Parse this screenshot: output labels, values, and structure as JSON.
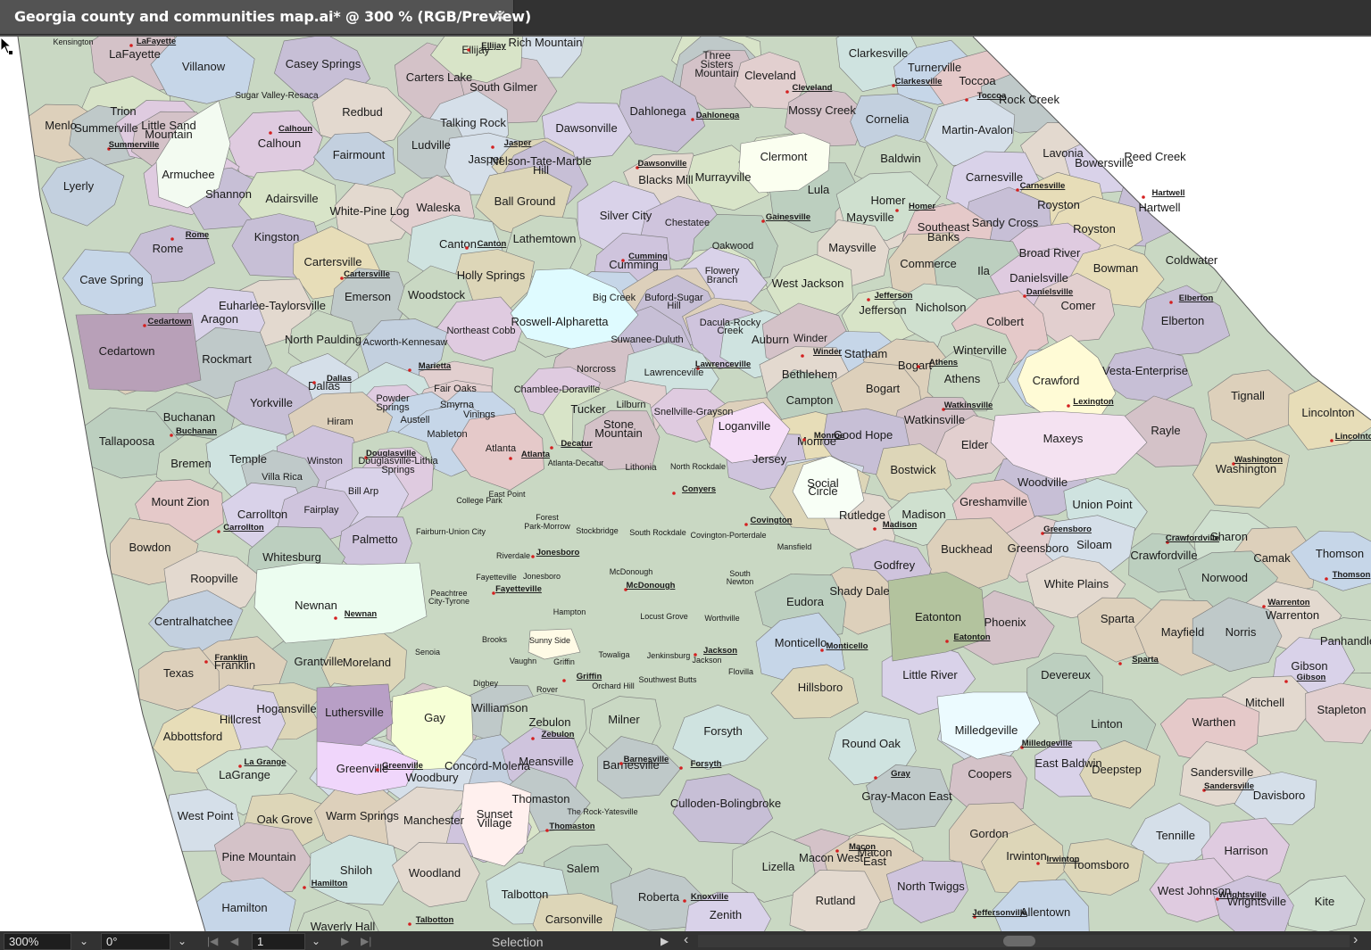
{
  "window": {
    "tab_title": "Georgia county and communities map.ai* @ 300 % (RGB/Preview)",
    "close_glyph": "✕"
  },
  "map": {
    "background": "#ffffff",
    "border_color": "#7a7a7a",
    "palette": [
      "#cfc4dd",
      "#c9d8c3",
      "#e2cfcf",
      "#d5dfe9",
      "#ddd6b8",
      "#c3d0df",
      "#dfcbe0",
      "#cfe0cf",
      "#e3d9cf",
      "#bfc9c9",
      "#d9d2e9",
      "#cfe3e0",
      "#e7ddb8",
      "#c7bfd6",
      "#d8e4c8",
      "#e5c9c9",
      "#c6d6e8",
      "#ddd0bb",
      "#bccfbf",
      "#d4c2c8"
    ],
    "highlight_regions": {
      "roswell_alpharetta": "#dffbff",
      "clermont": "#fbfff0",
      "crawford": "#fffbd6",
      "maxeys": "#f4e2f1",
      "armuchee": "#f3fbf1",
      "newnan": "#ecfdf0",
      "gay": "#f6ffd6",
      "greenville": "#f0d6fb",
      "social_circle": "#f8fff6",
      "milledgeville": "#ecfbff",
      "sunset_village": "#fff0ee",
      "sunny_side": "#fffbe6",
      "loganville": "#f6dff8",
      "cedartown": "#b8a0b8",
      "luthersville": "#b89fc6",
      "eatonton": "#b3c39e"
    },
    "city_dot_color": "#d42020",
    "text_color": "#1a1a1a",
    "cities": [
      "LaFayette",
      "Ellijay",
      "Calhoun",
      "Summerville",
      "Rome",
      "Cartersville",
      "Cedartown",
      "Dallas",
      "Marietta",
      "Douglasville",
      "Buchanan",
      "Carrollton",
      "Atlanta",
      "Decatur",
      "Conyers",
      "Covington",
      "Lawrenceville",
      "Gainesville",
      "Cumming",
      "Canton",
      "Jasper",
      "Dahlonega",
      "Dawsonville",
      "Cleveland",
      "Clarkesville",
      "Toccoa",
      "Hartwell",
      "Carnesville",
      "Homer",
      "Jefferson",
      "Danielsville",
      "Elberton",
      "Athens",
      "Winder",
      "Watkinsville",
      "Lexington",
      "Washington",
      "Monroe",
      "Madison",
      "Greensboro",
      "Crawfordville",
      "Warrenton",
      "Thomson",
      "Sparta",
      "Eatonton",
      "Gibson",
      "Milledgeville",
      "Sandersville",
      "Wrightsville",
      "Irwinton",
      "Jeffersonville",
      "Gray",
      "Macon",
      "Knoxville",
      "Forsyth",
      "Monticello",
      "Jackson",
      "McDonough",
      "Jonesboro",
      "Fayetteville",
      "Griffin",
      "Barnesville",
      "Zebulon",
      "Thomaston",
      "Talbotton",
      "Hamilton",
      "Greenville",
      "La Grange",
      "Franklin",
      "Newnan",
      "Lincolnton"
    ],
    "labels": [
      "Kensington",
      "LaFayette",
      "Villanow",
      "Casey Springs",
      "Rich Mountain",
      "Carters Lake",
      "South Gilmer",
      "Three Sisters Mountain",
      "Cleveland",
      "Clarkesville",
      "Turnerville",
      "Toccoa",
      "Rock Creek",
      "Dahlonega",
      "Mossy Creek",
      "Cornelia",
      "Martin-Avalon",
      "Trion",
      "Menlo",
      "Summerville",
      "Little Sand Mountain",
      "Sugar Valley-Resaca",
      "Redbud",
      "Talking Rock",
      "Dawsonville",
      "Calhoun",
      "Fairmount",
      "Ludville",
      "Jasper",
      "Nelson-Tate-Marble Hill",
      "Blacks Mill",
      "Murrayville",
      "Clermont",
      "Baldwin",
      "Lavonia",
      "Bowersville",
      "Reed Creek",
      "Carnesville",
      "Lyerly",
      "Armuchee",
      "Shannon",
      "Adairsville",
      "White-Pine Log",
      "Waleska",
      "Ball Ground",
      "Silver City",
      "Chestatee",
      "Lula",
      "Maysville",
      "Homer",
      "Royston",
      "Hartwell",
      "Sandy Cross",
      "Southeast Banks",
      "Kingston",
      "Rome",
      "Canton",
      "Lathemtown",
      "Cumming",
      "Oakwood",
      "Broad River",
      "Coldwater",
      "Cave Spring",
      "Cartersville",
      "Holly Springs",
      "Flowery Branch",
      "West Jackson",
      "Commerce",
      "Ila",
      "Danielsville",
      "Bowman",
      "Emerson",
      "Woodstock",
      "Big Creek",
      "Buford-Sugar Hill",
      "Comer",
      "Elberton",
      "Euharlee-Taylorsville",
      "Jefferson",
      "Nicholson",
      "Aragon",
      "Roswell-Alpharetta",
      "Dacula-Rocky Creek",
      "Colbert",
      "Northeast Cobb",
      "Suwanee-Duluth",
      "Auburn",
      "North Paulding",
      "Acworth-Kennesaw",
      "Cedartown",
      "Winder",
      "Statham",
      "Winterville",
      "Rockmart",
      "Norcross",
      "Lawrenceville",
      "Bogart",
      "Crawford",
      "Vesta-Enterprise",
      "Dallas",
      "Fair Oaks",
      "Bethlehem",
      "Athens",
      "Chamblee-Doraville",
      "Powder Springs",
      "Smyrna",
      "Tignall",
      "Lincolnton",
      "Buchanan",
      "Yorkville",
      "Austell",
      "Vinings",
      "Lilburn",
      "Tucker",
      "Snellville-Grayson",
      "Campton",
      "Hiram",
      "Mableton",
      "Stone Mountain",
      "Watkinsville",
      "Maxeys",
      "Loganville",
      "Rayle",
      "Tallapoosa",
      "Monroe",
      "Good Hope",
      "Elder",
      "Bremen",
      "Temple",
      "Winston",
      "Douglasville-Lithia Springs",
      "Atlanta",
      "Atlanta-Decatur",
      "Jersey",
      "Bostwick",
      "Lithonia",
      "North Rockdale",
      "Villa Rica",
      "Social Circle",
      "Woodville",
      "Washington",
      "East Point",
      "Bill Arp",
      "College Park",
      "Mount Zion",
      "Carrollton",
      "Fairplay",
      "Forest Park-Morrow",
      "Rutledge",
      "Madison",
      "Greshamville",
      "Union Point",
      "Fairburn-Union City",
      "Stockbridge",
      "South Rockdale",
      "Covington-Porterdale",
      "Bowdon",
      "Palmetto",
      "Riverdale",
      "Greensboro",
      "Crawfordville",
      "Sharon",
      "Whitesburg",
      "Jonesboro",
      "Mansfield",
      "Siloam",
      "Camak",
      "Thomson",
      "South Newton",
      "Buckhead",
      "Godfrey",
      "McDonough",
      "Roopville",
      "Fayetteville",
      "Peachtree City-Tyrone",
      "White Plains",
      "Norwood",
      "Newnan",
      "Shady Dale",
      "Eudora",
      "Hampton",
      "Eatonton",
      "Sparta",
      "Warrenton",
      "Centralhatchee",
      "Locust Grove",
      "Phoenix",
      "Mayfield",
      "Norris",
      "Worthville",
      "Panhandle",
      "Brooks",
      "Sunny Side",
      "Monticello",
      "Grantville",
      "Moreland",
      "Senoia",
      "Towaliga",
      "Jenkinsburg",
      "Franklin",
      "Vaughn",
      "Griffin",
      "Flovilla",
      "Texas",
      "Little River",
      "Devereux",
      "Gibson",
      "Digbey",
      "Southwest Butts",
      "Orchard Hill",
      "Hillsboro",
      "Rover",
      "Hogansville",
      "Luthersville",
      "Gay",
      "Mitchell",
      "Stapleton",
      "Williamson",
      "Milner",
      "Linton",
      "Hillcrest",
      "Forsyth",
      "Milledgeville",
      "Warthen",
      "Zebulon",
      "Round Oak",
      "Abbottsford",
      "East Baldwin",
      "Deepstep",
      "Greenville",
      "Concord-Molena",
      "Meansville",
      "Barnesville",
      "Sandersville",
      "LaGrange",
      "Coopers",
      "Woodbury",
      "Davisboro",
      "Thomaston",
      "Culloden-Bolingbroke",
      "Gray-Macon East",
      "The Rock-Yatesville",
      "West Point",
      "Oak Grove",
      "Warm Springs",
      "Manchester",
      "Sunset Village",
      "Tennille",
      "Gordon",
      "Pine Mountain",
      "Macon West",
      "Macon East",
      "Irwinton",
      "Toomsboro",
      "Harrison",
      "Shiloh",
      "Salem",
      "Lizella",
      "North Twiggs",
      "Woodland",
      "West Johnson",
      "Kite",
      "Talbotton",
      "Roberta",
      "Rutland",
      "Wrightsville",
      "Hamilton",
      "Zenith",
      "Allentown",
      "Waverly Hall",
      "Carsonville"
    ]
  },
  "status_bar": {
    "zoom": "300%",
    "rotation": "0°",
    "artboard": "1",
    "tool": "Selection",
    "first_glyph": "|◀",
    "prev_glyph": "◀",
    "next_glyph": "▶",
    "last_glyph": "▶|",
    "dropdown_glyph": "⌄",
    "play_glyph": "▶",
    "scroll_left_glyph": "‹",
    "scroll_right_glyph": "›"
  }
}
